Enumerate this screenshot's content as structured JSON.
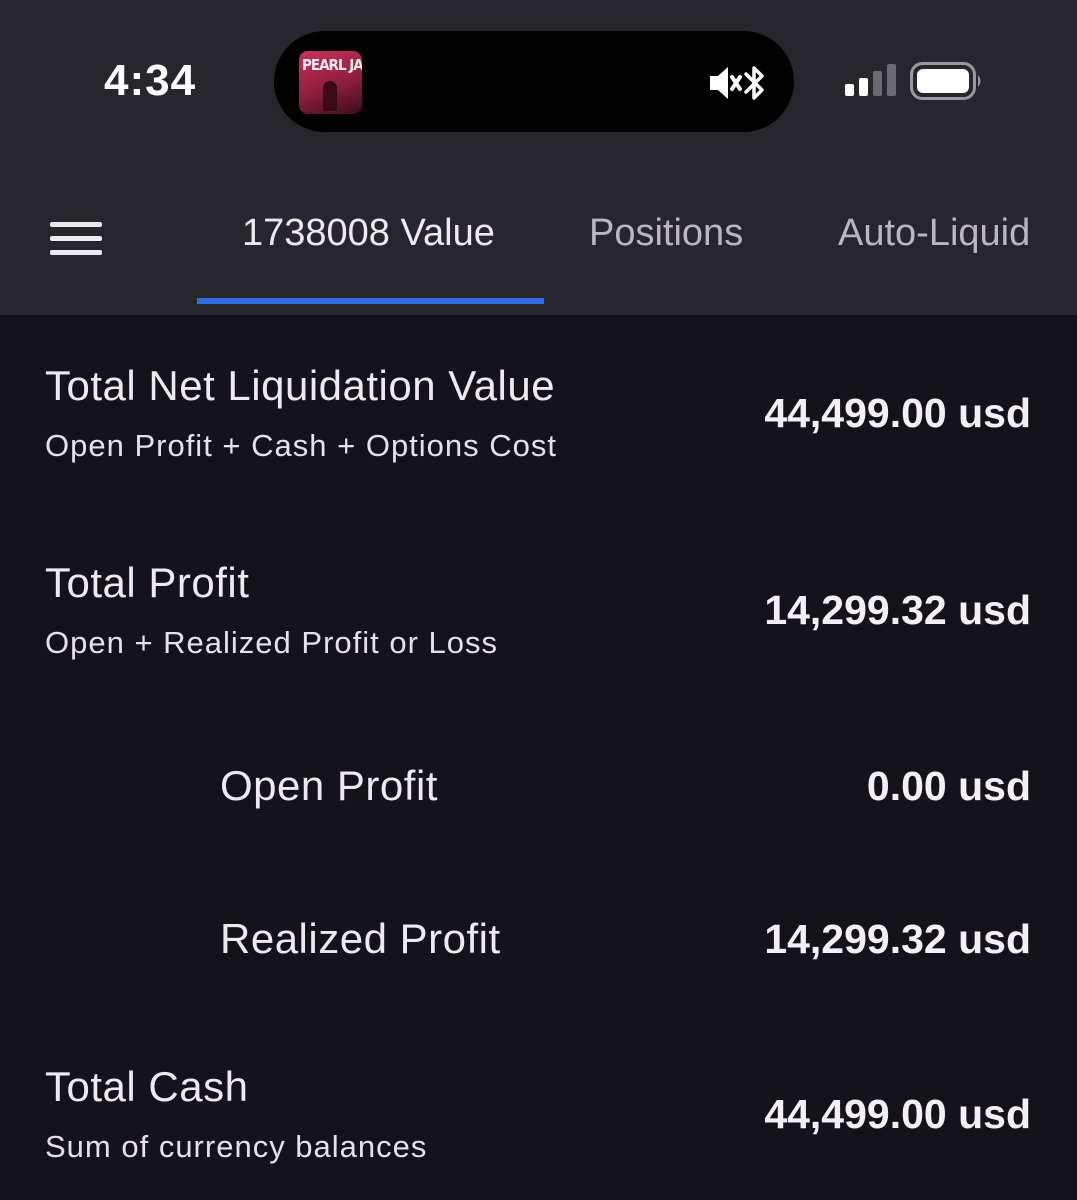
{
  "status_bar": {
    "time": "4:34",
    "now_playing_album_text": "PEARL JAM",
    "icons": [
      "album-art",
      "speaker-mute-icon",
      "bluetooth-icon",
      "cellular-signal-icon",
      "battery-icon"
    ]
  },
  "header": {
    "menu_icon": "hamburger-menu-icon",
    "tabs": [
      {
        "label": "1738008 Value",
        "active": true
      },
      {
        "label": "Positions",
        "active": false
      },
      {
        "label": "Auto-Liquid",
        "active": false
      }
    ],
    "accent_color": "#2f6fe4"
  },
  "summary": {
    "net_liquidation": {
      "title": "Total Net Liquidation Value",
      "subtitle": "Open Profit + Cash + Options Cost",
      "value": "44,499.00 usd"
    },
    "total_profit": {
      "title": "Total Profit",
      "subtitle": "Open + Realized Profit or Loss",
      "value": "14,299.32 usd"
    },
    "open_profit": {
      "title": "Open Profit",
      "value": "0.00 usd"
    },
    "realized_profit": {
      "title": "Realized Profit",
      "value": "14,299.32 usd"
    },
    "total_cash": {
      "title": "Total Cash",
      "subtitle": "Sum of currency balances",
      "value": "44,499.00 usd"
    }
  }
}
